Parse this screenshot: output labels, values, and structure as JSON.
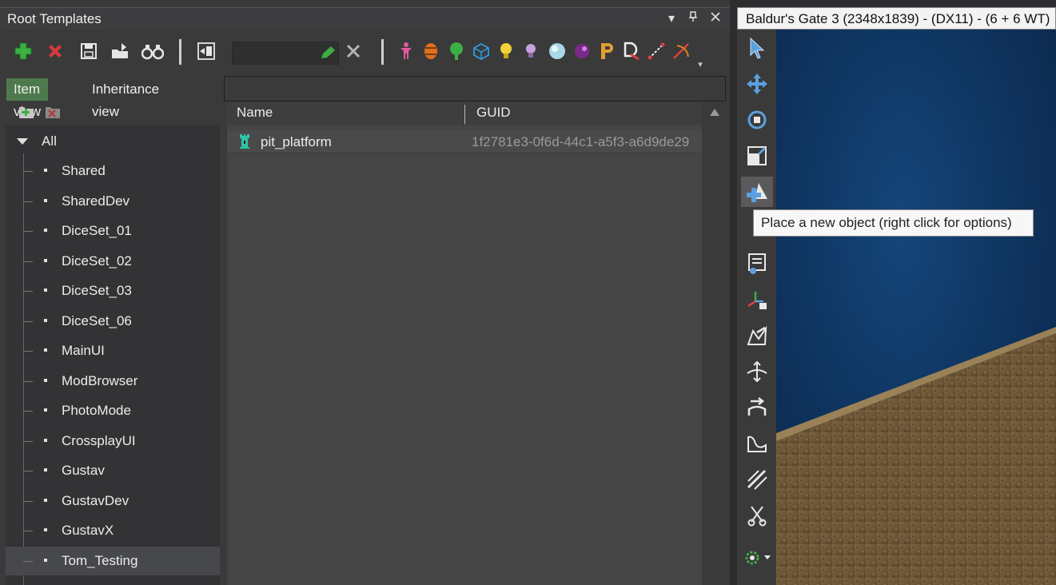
{
  "panel": {
    "title": "Root Templates",
    "filter_value": "",
    "tabs": [
      "Item view",
      "Inheritance view"
    ]
  },
  "tree": {
    "root": "All",
    "items": [
      "Shared",
      "SharedDev",
      "DiceSet_01",
      "DiceSet_02",
      "DiceSet_03",
      "DiceSet_06",
      "MainUI",
      "ModBrowser",
      "PhotoMode",
      "CrossplayUI",
      "Gustav",
      "GustavDev",
      "GustavX",
      "Tom_Testing"
    ],
    "selected": "Tom_Testing"
  },
  "list": {
    "columns": {
      "name": "Name",
      "guid": "GUID"
    },
    "rows": [
      {
        "name": "pit_platform",
        "guid": "1f2781e3-0f6d-44c1-a5f3-a6d9de29"
      }
    ]
  },
  "viewport": {
    "title": "Baldur's Gate 3 (2348x1839) - (DX11) - (6 + 6 WT)",
    "tooltip": "Place a new object (right click for options)"
  },
  "colors": {
    "panel_bg": "#3a3a3a",
    "tab_active": "#4d7a4d",
    "water": "#0f2f55",
    "ground": "#6b5637"
  }
}
